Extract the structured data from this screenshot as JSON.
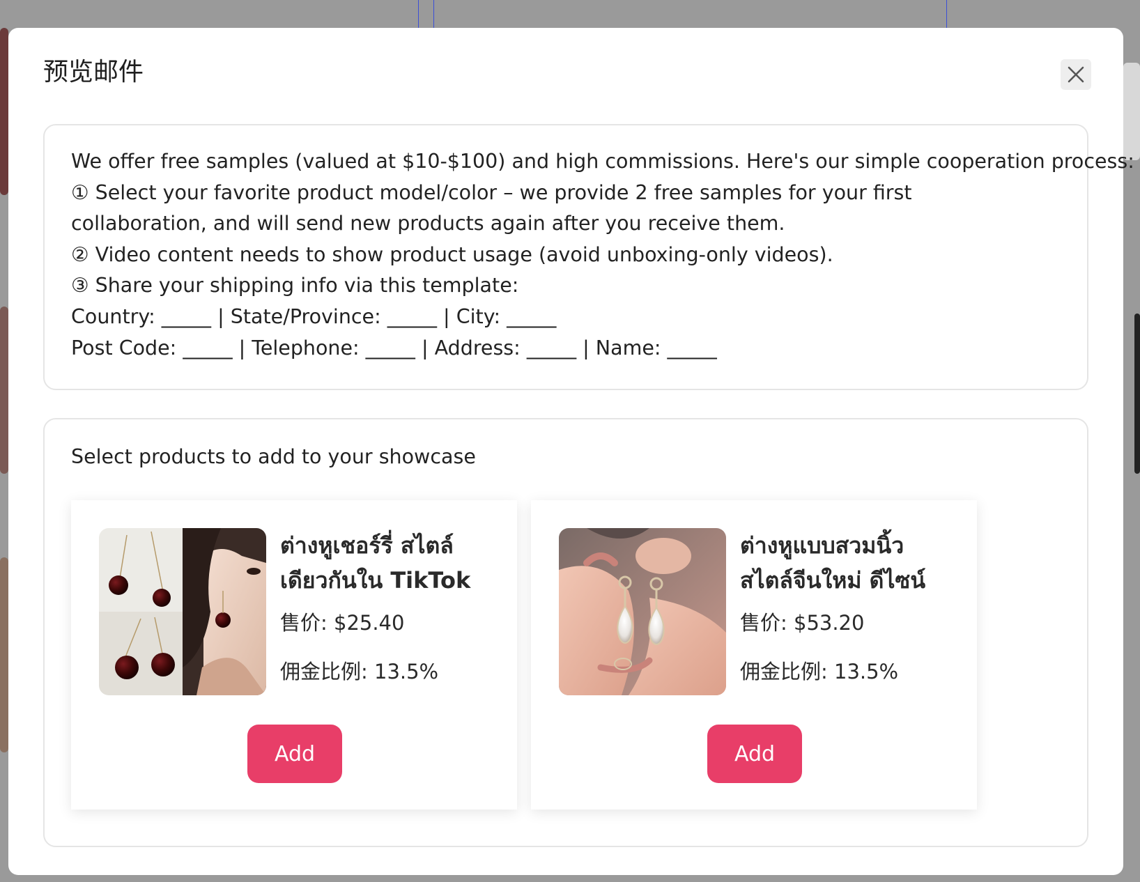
{
  "modal": {
    "title": "预览邮件",
    "close_label": "×"
  },
  "message": {
    "lines": [
      "We offer free samples (valued at $10-$100) and high commissions. Here's our simple cooperation process:",
      "① Select your favorite product model/color – we provide 2 free samples for your first collaboration, and will send new products again after you receive them.",
      "② Video content needs to show product usage (avoid unboxing-only videos).",
      "③ Share your shipping info via this template:",
      "Country: _____ | State/Province: _____ | City: _____",
      "Post Code: _____ | Telephone: _____ | Address: _____ | Name: _____"
    ]
  },
  "products": {
    "heading": "Select products to add to your showcase",
    "items": [
      {
        "name_line1": "ต่างหูเชอร์รี่ สไตล์",
        "name_line2": "เดียวกันใน TikTok",
        "price": "售价: $25.40",
        "commission": "佣金比例: 13.5%",
        "button": "Add",
        "image": "cherry-earrings-photo"
      },
      {
        "name_line1": "ต่างหูแบบสวมนิ้ว",
        "name_line2": "สไตล์จีนใหม่ ดีไซน์",
        "price": "售价: $53.20",
        "commission": "佣金比例: 13.5%",
        "button": "Add",
        "image": "crystal-drop-earrings-photo"
      }
    ]
  },
  "colors": {
    "accent": "#e83e68",
    "overlay": "#9a9a9a"
  }
}
